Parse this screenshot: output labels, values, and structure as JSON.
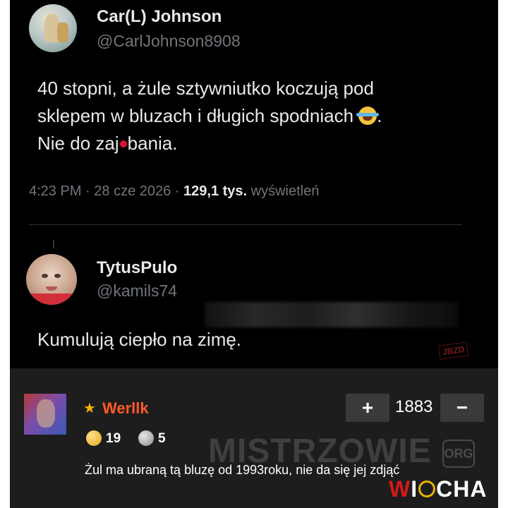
{
  "tweet": {
    "author_name": "Car(L) Johnson",
    "author_handle": "@CarlJohnson8908",
    "text_line1": "40 stopni, a żule sztywniutko koczują pod",
    "text_line2": "sklepem w bluzach i długich spodniach",
    "text_line3_a": "Nie do zaj",
    "text_line3_b": "bania.",
    "time": "4:23 PM",
    "date": "28 cze 2026",
    "views_count": "129,1 tys.",
    "views_label": "wyświetleń",
    "emoji": "joy-emoji-icon"
  },
  "reply": {
    "author_name": "TytusPulo",
    "author_handle": "@kamils74",
    "text": "Kumulują ciepło na zimę."
  },
  "watermarks": {
    "jbzd": "JBZD",
    "mistrzowie": "MISTRZOWIE",
    "org": "ORG",
    "wiocha_w": "W",
    "wiocha_i": "I",
    "wiocha_rest": "CHA"
  },
  "comment": {
    "username": "Werllk",
    "score": "1883",
    "plus_label": "+",
    "minus_label": "−",
    "gold_count": "19",
    "silver_count": "5",
    "text": "Żul ma ubraną tą bluzę od 1993roku, nie da się jej zdjąć"
  },
  "colors": {
    "tweet_bg": "#000000",
    "comment_bg": "#1d1d1d",
    "username_accent": "#ff5b24",
    "muted_text": "#71767b"
  }
}
